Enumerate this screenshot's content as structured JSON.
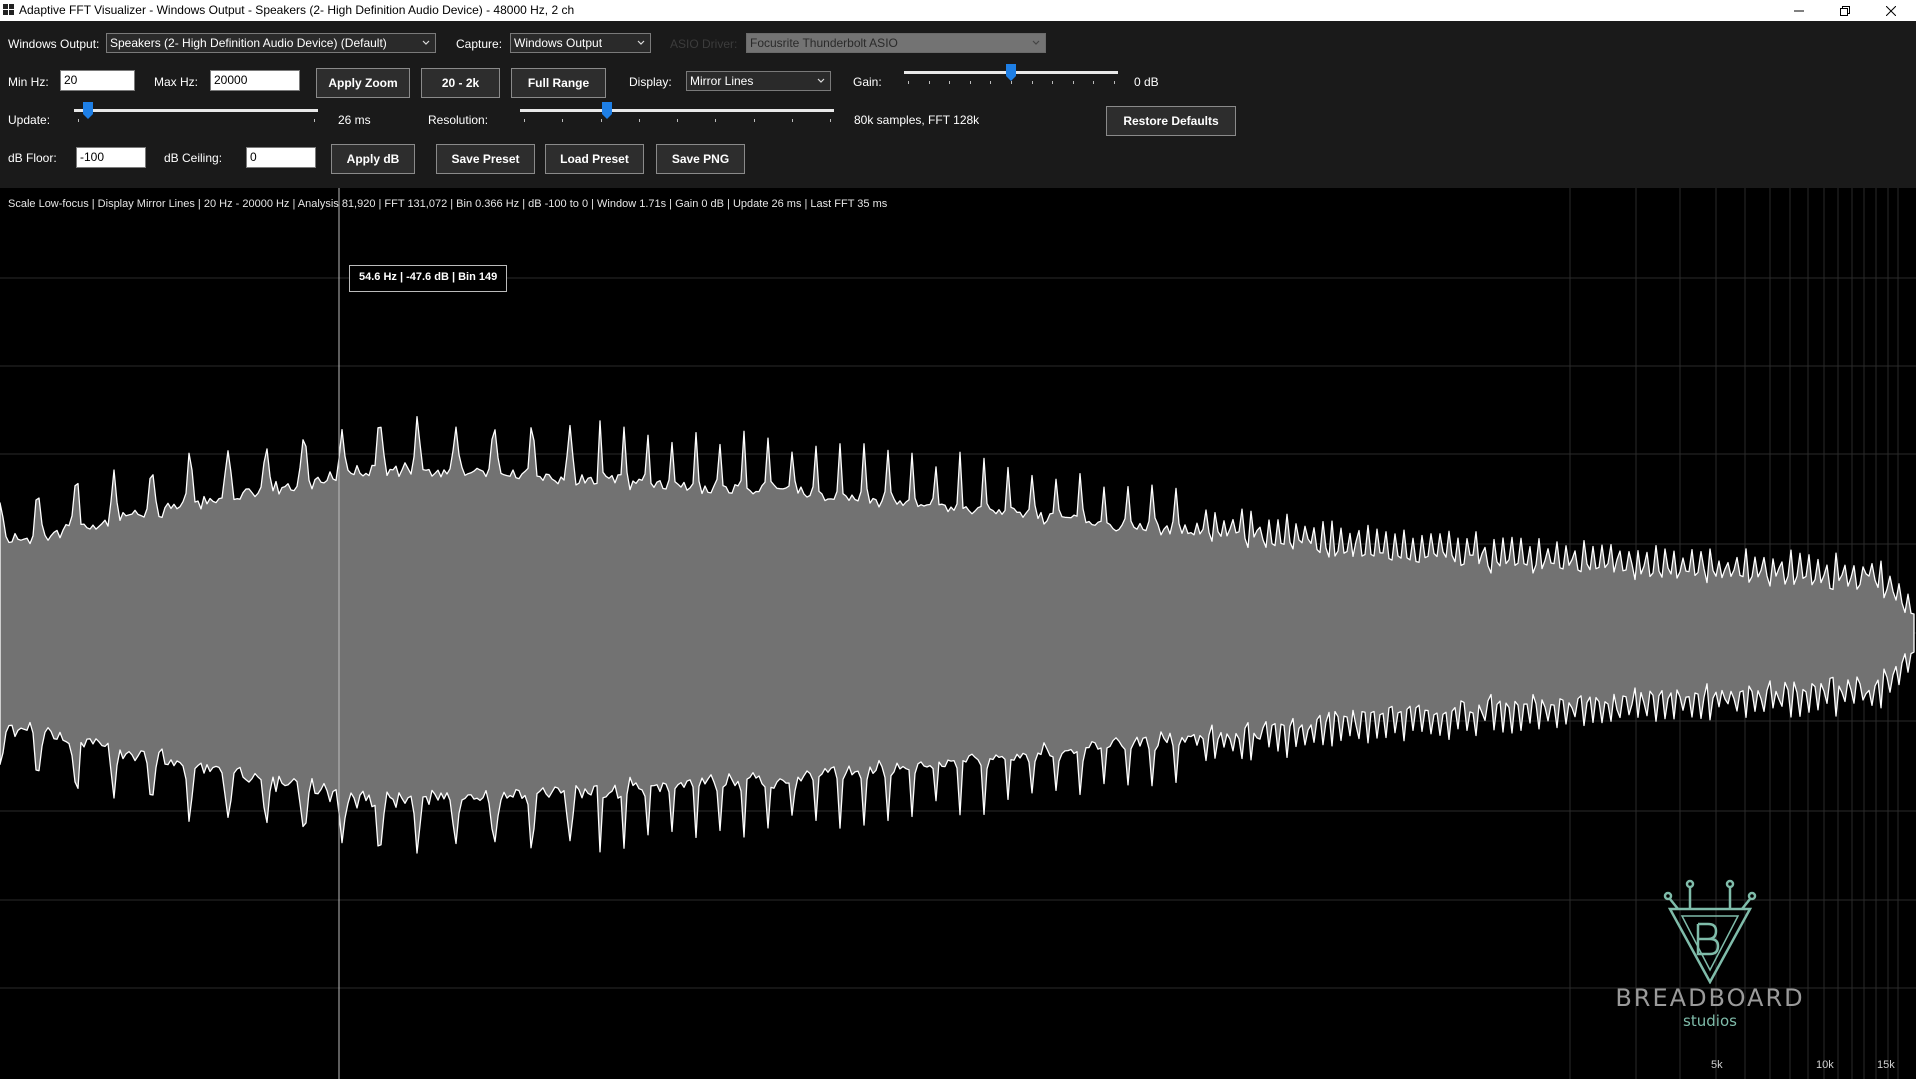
{
  "window": {
    "title": "Adaptive FFT Visualizer - Windows Output - Speakers (2- High Definition Audio Device) - 48000 Hz, 2 ch",
    "buttons": [
      "minimize-icon",
      "restore-icon",
      "close-icon"
    ]
  },
  "toolbar": {
    "windows_output_label": "Windows Output:",
    "windows_output_value": "Speakers (2- High Definition Audio Device) (Default)",
    "capture_label": "Capture:",
    "capture_value": "Windows Output",
    "asio_label": "ASIO Driver:",
    "asio_value": "Focusrite Thunderbolt ASIO",
    "min_hz_label": "Min Hz:",
    "min_hz_value": "20",
    "max_hz_label": "Max Hz:",
    "max_hz_value": "20000",
    "apply_zoom": "Apply Zoom",
    "range_20_2k": "20 - 2k",
    "full_range": "Full Range",
    "display_label": "Display:",
    "display_value": "Mirror Lines",
    "gain_label": "Gain:",
    "gain_value": "0 dB",
    "update_label": "Update:",
    "update_value": "26 ms",
    "resolution_label": "Resolution:",
    "resolution_value": "80k samples, FFT 128k",
    "restore_defaults": "Restore Defaults",
    "db_floor_label": "dB Floor:",
    "db_floor_value": "-100",
    "db_ceiling_label": "dB Ceiling:",
    "db_ceiling_value": "0",
    "apply_db": "Apply dB",
    "save_preset": "Save Preset",
    "load_preset": "Load Preset",
    "save_png": "Save PNG",
    "sliders": {
      "gain_fraction": 0.5,
      "update_fraction": 0.04,
      "resolution_fraction": 0.27
    }
  },
  "visualizer": {
    "status": "Scale Low-focus | Display Mirror Lines | 20 Hz - 20000 Hz | Analysis 81,920 | FFT 131,072 | Bin 0.366 Hz | dB -100 to 0 | Window 1.71s | Gain 0 dB | Update 26 ms | Last FFT 35 ms",
    "tooltip": "54.6 Hz  |  -47.6 dB  |  Bin 149",
    "axis_labels": [
      "5k",
      "10k",
      "15k"
    ],
    "colors": {
      "fill": "#727272",
      "outline": "#ffffff",
      "grid": "#2a2a2a",
      "background": "#000000"
    }
  },
  "logo": {
    "brand": "BREADBOARD",
    "sub": "studios"
  }
}
